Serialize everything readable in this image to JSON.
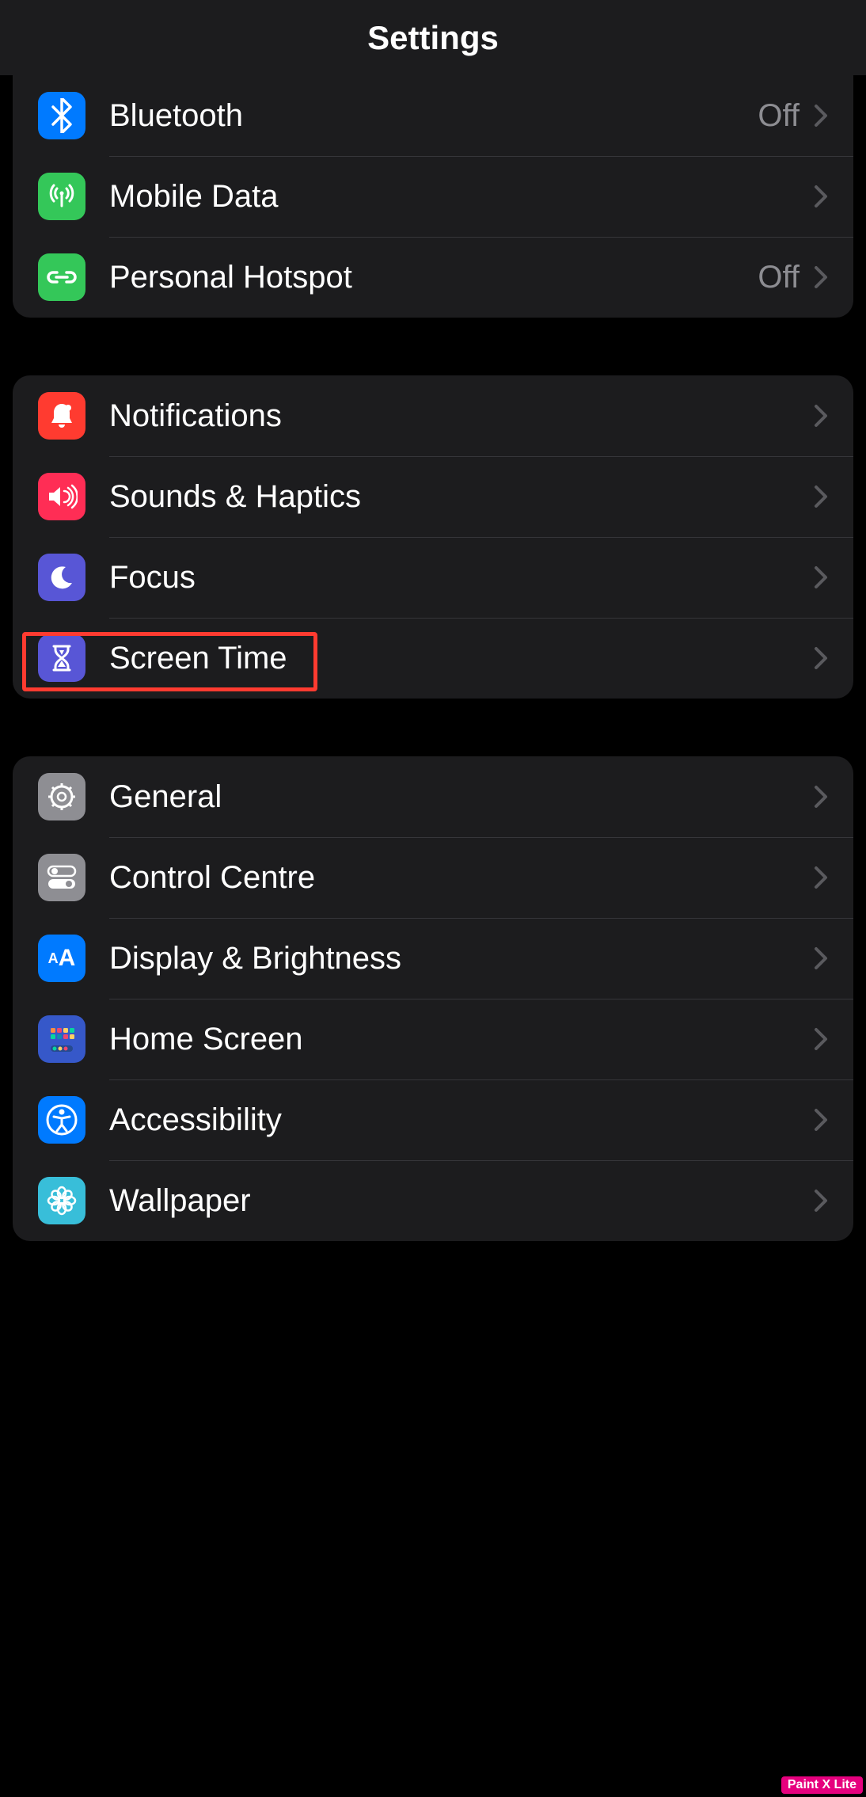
{
  "header": {
    "title": "Settings"
  },
  "groups": [
    {
      "rows": [
        {
          "id": "bluetooth",
          "label": "Bluetooth",
          "value": "Off",
          "icon": "bluetooth",
          "color": "#007aff"
        },
        {
          "id": "mobile-data",
          "label": "Mobile Data",
          "value": "",
          "icon": "antenna",
          "color": "#34c759"
        },
        {
          "id": "personal-hotspot",
          "label": "Personal Hotspot",
          "value": "Off",
          "icon": "link",
          "color": "#34c759"
        }
      ]
    },
    {
      "rows": [
        {
          "id": "notifications",
          "label": "Notifications",
          "value": "",
          "icon": "bell",
          "color": "#ff3b30"
        },
        {
          "id": "sounds-haptics",
          "label": "Sounds & Haptics",
          "value": "",
          "icon": "speaker",
          "color": "#ff2d55"
        },
        {
          "id": "focus",
          "label": "Focus",
          "value": "",
          "icon": "moon",
          "color": "#5856d6"
        },
        {
          "id": "screen-time",
          "label": "Screen Time",
          "value": "",
          "icon": "hourglass",
          "color": "#5856d6"
        }
      ]
    },
    {
      "rows": [
        {
          "id": "general",
          "label": "General",
          "value": "",
          "icon": "gear",
          "color": "#8e8e93"
        },
        {
          "id": "control-centre",
          "label": "Control Centre",
          "value": "",
          "icon": "toggles",
          "color": "#8e8e93"
        },
        {
          "id": "display-brightness",
          "label": "Display & Brightness",
          "value": "",
          "icon": "aa",
          "color": "#007aff"
        },
        {
          "id": "home-screen",
          "label": "Home Screen",
          "value": "",
          "icon": "grid",
          "color": "#3658c9"
        },
        {
          "id": "accessibility",
          "label": "Accessibility",
          "value": "",
          "icon": "accessibility",
          "color": "#007aff"
        },
        {
          "id": "wallpaper",
          "label": "Wallpaper",
          "value": "",
          "icon": "flower",
          "color": "#38bed9"
        }
      ]
    }
  ],
  "highlight": {
    "target": "screen-time"
  },
  "watermark": "Paint X Lite"
}
